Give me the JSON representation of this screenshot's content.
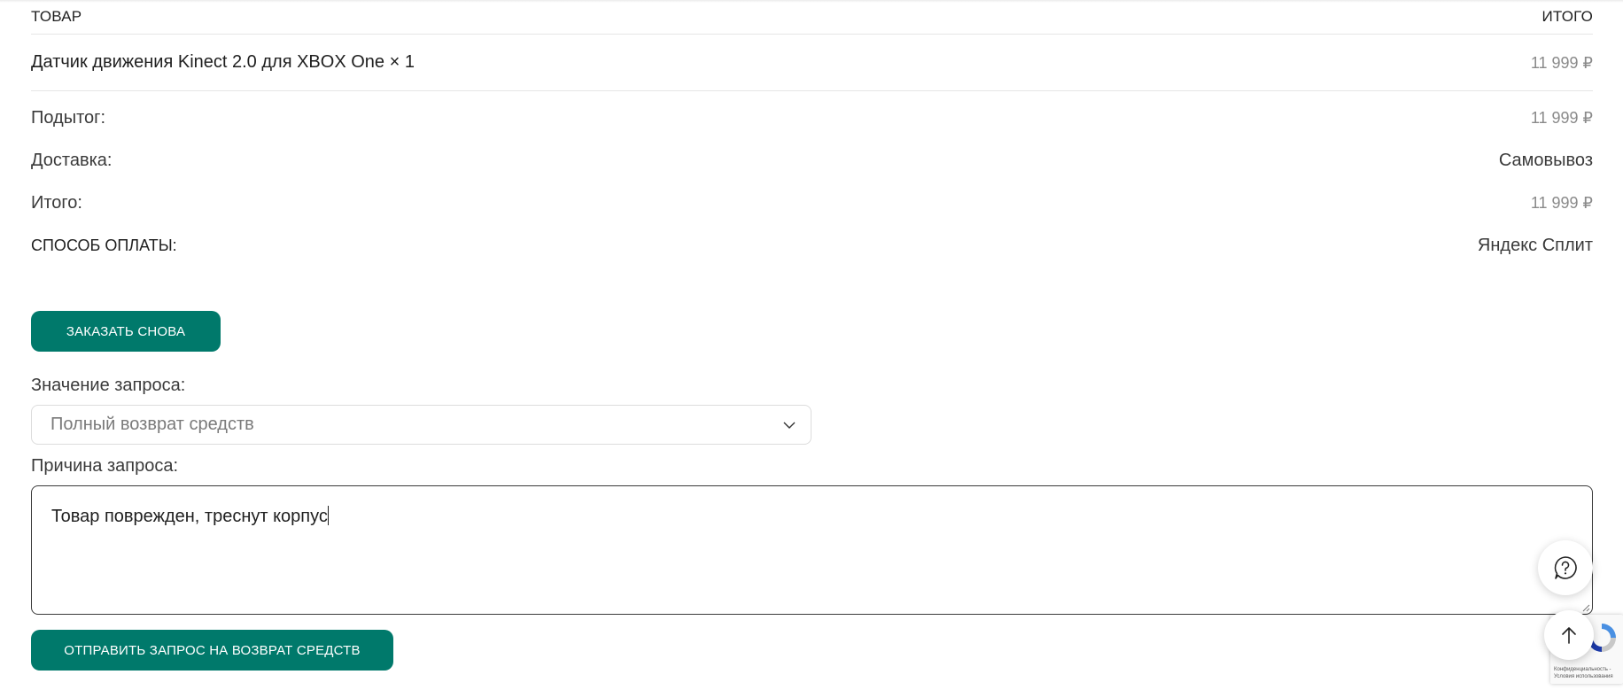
{
  "table": {
    "header": {
      "product": "Товар",
      "total": "Итого"
    },
    "items": [
      {
        "name": "Датчик движения Kinect 2.0 для XBOX One × 1",
        "price": "11 999 ₽"
      }
    ],
    "summary": {
      "subtotal_label": "Подытог:",
      "subtotal_value": "11 999 ₽",
      "shipping_label": "Доставка:",
      "shipping_value": "Самовывоз",
      "total_label": "Итого:",
      "total_value": "11 999 ₽",
      "payment_label": "Способ оплаты:",
      "payment_value": "Яндекс Сплит"
    }
  },
  "actions": {
    "reorder_label": "Заказать снова",
    "submit_refund_label": "Отправить запрос на возврат средств"
  },
  "refund_form": {
    "request_value_label": "Значение запроса:",
    "request_value_selected": "Полный возврат средств",
    "reason_label": "Причина запроса:",
    "reason_text": "Товар поврежден, треснут корпус"
  },
  "recaptcha": {
    "text_line1": "Конфиденциальность -",
    "text_line2": "Условия использования"
  },
  "colors": {
    "accent": "#00796b",
    "muted_price": "#8a8a8a",
    "border": "#e6e6e6"
  },
  "icons": {
    "select_chevron": "chevron-down-icon",
    "help": "question-circle-icon",
    "scroll_top": "arrow-up-icon",
    "recaptcha": "recaptcha-logo-icon"
  }
}
